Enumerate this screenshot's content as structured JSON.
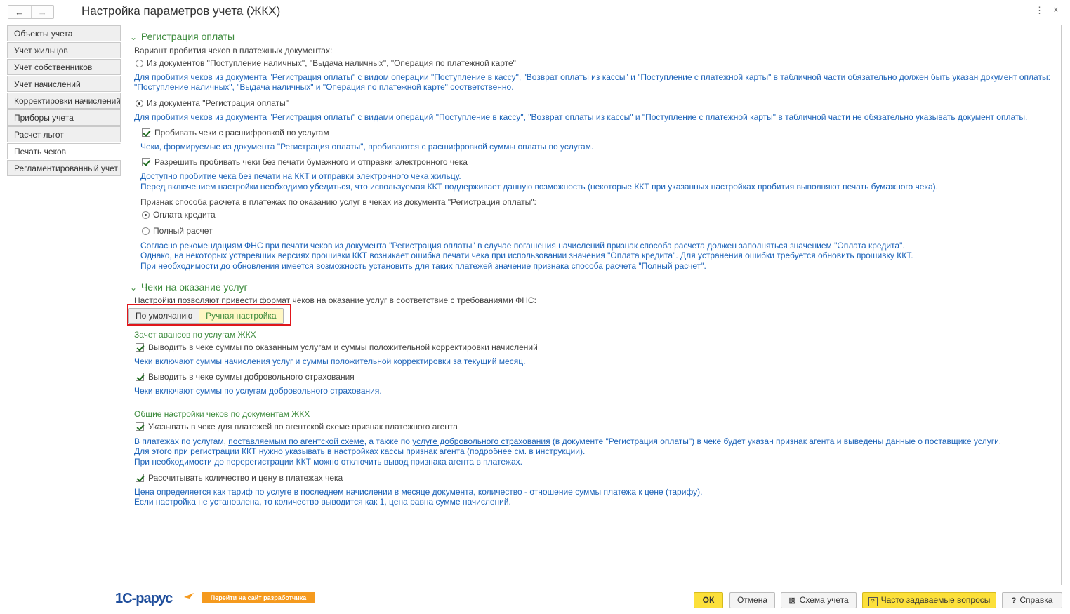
{
  "window": {
    "title": "Настройка параметров учета (ЖКХ)",
    "back_icon": "←",
    "forward_icon": "→",
    "more_icon": "⋮",
    "close_icon": "×"
  },
  "sidebar": {
    "items": [
      {
        "label": "Объекты учета"
      },
      {
        "label": "Учет жильцов"
      },
      {
        "label": "Учет собственников"
      },
      {
        "label": "Учет начислений"
      },
      {
        "label": "Корректировки начислений"
      },
      {
        "label": "Приборы учета"
      },
      {
        "label": "Расчет льгот"
      },
      {
        "label": "Печать чеков",
        "active": true
      },
      {
        "label": "Регламентированный учет"
      }
    ]
  },
  "payment": {
    "section_title": "Регистрация оплаты",
    "variant_label": "Вариант пробития чеков в платежных документах:",
    "option1": {
      "label": "Из документов \"Поступление наличных\", \"Выдача наличных\", \"Операция по платежной карте\"",
      "selected": false
    },
    "option1_note1": "Для пробития чеков из документа \"Регистрация оплаты\" с видом операции \"Поступление в кассу\", \"Возврат оплаты из кассы\" и \"Поступление с платежной карты\" в табличной части обязательно должен быть указан документ оплаты:",
    "option1_note2": "\"Поступление наличных\", \"Выдача наличных\" и \"Операция по платежной карте\" соответственно.",
    "option2": {
      "label": "Из документа \"Регистрация оплаты\"",
      "selected": true
    },
    "option2_note": "Для пробития чеков из документа \"Регистрация оплаты\" с видами операций \"Поступление в кассу\", \"Возврат оплаты из кассы\" и \"Поступление с платежной карты\" в табличной части не обязательно указывать документ оплаты.",
    "chk_services": {
      "label": "Пробивать чеки с расшифровкой по услугам",
      "checked": true
    },
    "chk_services_note": "Чеки, формируемые из документа \"Регистрация оплаты\", пробиваются с расшифровкой суммы оплаты по услугам.",
    "chk_noprint": {
      "label": "Разрешить пробивать чеки без печати бумажного и отправки электронного чека",
      "checked": true
    },
    "chk_noprint_note1": "Доступно пробитие чека без печати на ККТ и отправки электронного чека жильцу.",
    "chk_noprint_note2": "Перед включением настройки необходимо убедиться, что используемая ККТ поддерживает данную возможность (некоторые ККТ при указанных настройках пробития выполняют печать бумажного чека).",
    "method_label": "Признак способа расчета в платежах по оказанию услуг в чеках из документа \"Регистрация оплаты\":",
    "method_credit": {
      "label": "Оплата кредита",
      "selected": true
    },
    "method_full": {
      "label": "Полный расчет",
      "selected": false
    },
    "method_note1": "Согласно рекомендациям ФНС при печати чеков из документа \"Регистрация оплаты\" в случае погашения начислений признак способа расчета должен заполняться значением \"Оплата кредита\".",
    "method_note2": "Однако, на некоторых устаревших версиях прошивки ККТ возникает ошибка печати чека при использовании значения \"Оплата кредита\". Для устранения ошибки требуется обновить прошивку ККТ.",
    "method_note3": "При необходимости до обновления имеется возможность установить для таких платежей значение признака способа расчета \"Полный расчет\"."
  },
  "services": {
    "section_title": "Чеки на оказание услуг",
    "intro": "Настройки позволяют привести формат чеков на оказание услуг в соответствие с требованиями ФНС:",
    "mode_default": "По умолчанию",
    "mode_manual": "Ручная настройка",
    "mode_selected": "Ручная настройка",
    "advance_title": "Зачет авансов по услугам ЖКХ",
    "chk_positive": {
      "label": "Выводить в чеке суммы по оказанным услугам и суммы положительной корректировки начислений",
      "checked": true
    },
    "chk_positive_note": "Чеки включают суммы начисления услуг и суммы положительной корректировки за текущий месяц.",
    "chk_insurance": {
      "label": "Выводить в чеке суммы добровольного страхования",
      "checked": true
    },
    "chk_insurance_note": "Чеки включают суммы по услугам добровольного страхования.",
    "general_title": "Общие настройки чеков по документам ЖКХ",
    "chk_agent": {
      "label": "Указывать в чеке для платежей по агентской схеме признак платежного агента",
      "checked": true
    },
    "agent_note1": {
      "p1": "В платежах по услугам, ",
      "link1": "поставляемым по агентской схеме",
      "p2": ", а также по ",
      "link2": "услуге добровольного страхования",
      "p3": " (в документе \"Регистрация оплаты\") в чеке будет указан признак агента и выведены данные о поставщике услуги."
    },
    "agent_note2": {
      "p1": "Для этого при регистрации ККТ нужно указывать в настройках кассы признак агента (",
      "link": "подробнее см. в инструкции",
      "p2": ")."
    },
    "agent_note3": "При необходимости до перерегистрации ККТ можно отключить вывод признака агента в платежах.",
    "chk_qty": {
      "label": "Рассчитывать количество и цену в платежах чека",
      "checked": true
    },
    "qty_note1": "Цена определяется как тариф по услуге в последнем начислении в месяце документа, количество - отношение суммы платежа к цене (тарифу).",
    "qty_note2": "Если настройка не установлена, то количество выводится как 1, цена равна сумме начислений."
  },
  "footer": {
    "logo_text": "1С-Рарус",
    "site_button": "Перейти на сайт разработчика",
    "ok": "ОК",
    "cancel": "Отмена",
    "scheme": "Схема учета",
    "faq": "Часто задаваемые вопросы",
    "help": "Справка",
    "help_icon": "?",
    "faq_icon": "?"
  },
  "colors": {
    "accent_green": "#3c8a3c",
    "link_blue": "#1b62b8",
    "highlight_red": "#e0161b",
    "button_yellow": "#fce03a",
    "site_orange": "#f59a1e"
  }
}
